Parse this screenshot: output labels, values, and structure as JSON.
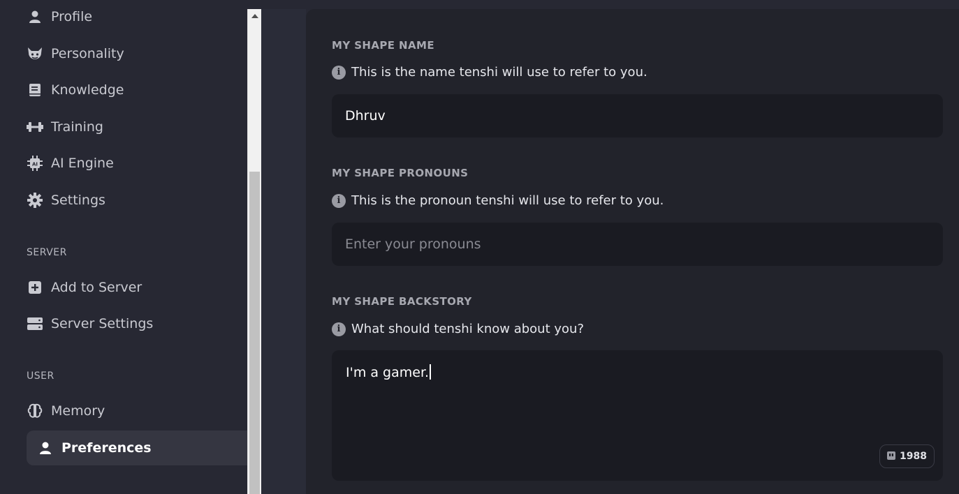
{
  "sidebar": {
    "items": [
      {
        "label": "Profile",
        "icon": "person-icon"
      },
      {
        "label": "Personality",
        "icon": "devil-face-icon"
      },
      {
        "label": "Knowledge",
        "icon": "book-icon"
      },
      {
        "label": "Training",
        "icon": "dumbbell-icon"
      },
      {
        "label": "AI Engine",
        "icon": "ai-chip-icon"
      },
      {
        "label": "Settings",
        "icon": "gear-icon"
      }
    ],
    "server_section": "SERVER",
    "server_items": [
      {
        "label": "Add to Server",
        "icon": "plus-square-icon"
      },
      {
        "label": "Server Settings",
        "icon": "server-icon"
      }
    ],
    "user_section": "USER",
    "user_items": [
      {
        "label": "Memory",
        "icon": "brain-icon"
      },
      {
        "label": "Preferences",
        "icon": "person-icon",
        "active": true
      }
    ]
  },
  "form": {
    "name": {
      "title": "MY SHAPE NAME",
      "hint": "This is the name tenshi will use to refer to you.",
      "value": "Dhruv"
    },
    "pronouns": {
      "title": "MY SHAPE PRONOUNS",
      "hint": "This is the pronoun tenshi will use to refer to you.",
      "placeholder": "Enter your pronouns"
    },
    "backstory": {
      "title": "MY SHAPE BACKSTORY",
      "hint": "What should tenshi know about you?",
      "value": "I'm a gamer.",
      "char_count": "1988"
    }
  },
  "colors": {
    "background": "#272833",
    "panel": "#22232b",
    "input": "#1a1b22",
    "active_item": "#353641"
  }
}
